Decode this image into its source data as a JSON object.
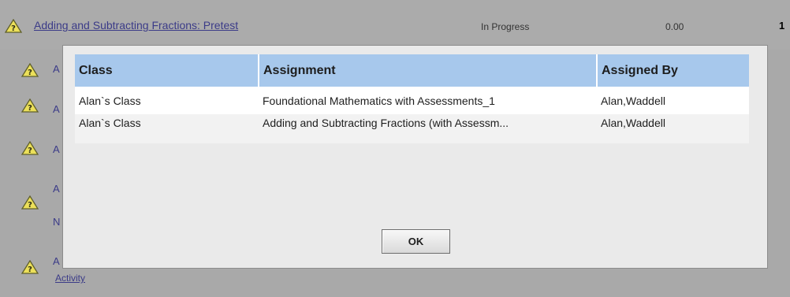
{
  "background_rows": [
    {
      "link": "Adding and Subtracting Fractions: Pretest",
      "status": "In Progress",
      "score": "0.00",
      "count": "1"
    },
    {
      "partial_text": "A"
    },
    {
      "partial_text": "A"
    },
    {
      "partial_text": "A"
    },
    {
      "partial_text": "A",
      "partial_text_2": "N"
    },
    {
      "partial_text": "A",
      "link": "Activity"
    }
  ],
  "dialog": {
    "columns": [
      "Class",
      "Assignment",
      "Assigned By"
    ],
    "rows": [
      {
        "class": "Alan`s Class",
        "assignment": "Foundational Mathematics with Assessments_1",
        "assigned_by": "Alan,Waddell"
      },
      {
        "class": "Alan`s Class",
        "assignment": "Adding and Subtracting Fractions (with Assessm...",
        "assigned_by": "Alan,Waddell"
      }
    ],
    "ok_label": "OK"
  },
  "colors": {
    "overlay": "#a9a9a9",
    "header_blue": "#a7c8ec",
    "dialog_bg": "#eaeaea",
    "link": "#3b3b88",
    "warning_fill": "#ece05a"
  },
  "icons": [
    "warning-question-icon"
  ]
}
